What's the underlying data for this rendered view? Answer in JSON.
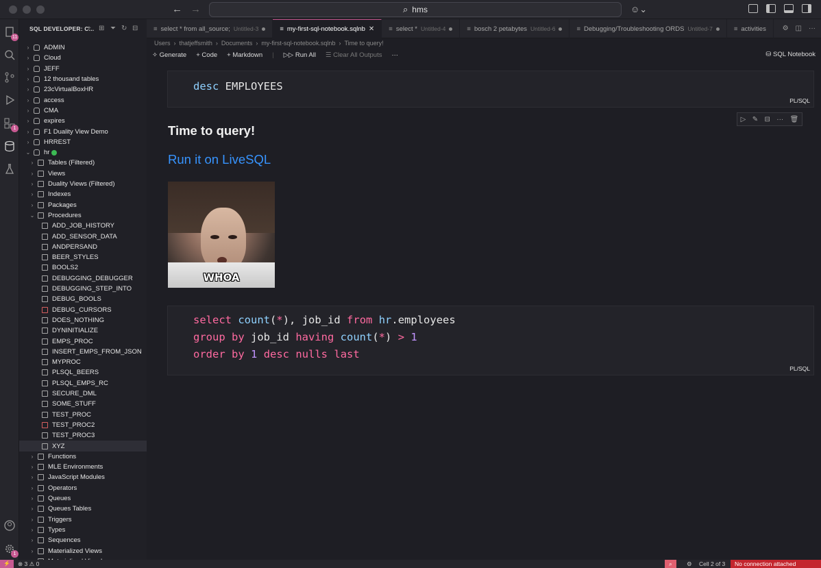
{
  "window": {
    "search_text": "hms",
    "back": "←",
    "forward": "→"
  },
  "sidebar": {
    "title": "SQL DEVELOPER: C...",
    "tree": [
      {
        "label": "ADMIN",
        "level": 0,
        "icon": "db",
        "chev": "›"
      },
      {
        "label": "Cloud",
        "level": 0,
        "icon": "db",
        "chev": "›"
      },
      {
        "label": "JEFF",
        "level": 0,
        "icon": "db",
        "chev": "›"
      },
      {
        "label": "12 thousand tables",
        "level": 0,
        "icon": "db",
        "chev": "›"
      },
      {
        "label": "23cVirtualBoxHR",
        "level": 0,
        "icon": "db",
        "chev": "›"
      },
      {
        "label": "access",
        "level": 0,
        "icon": "db",
        "chev": "›"
      },
      {
        "label": "CMA",
        "level": 0,
        "icon": "db",
        "chev": "›"
      },
      {
        "label": "expires",
        "level": 0,
        "icon": "db",
        "chev": "›"
      },
      {
        "label": "F1 Duality View Demo",
        "level": 0,
        "icon": "db",
        "chev": "›"
      },
      {
        "label": "HRREST",
        "level": 0,
        "icon": "db",
        "chev": "›"
      },
      {
        "label": "hr",
        "level": 0,
        "icon": "db",
        "chev": "⌄",
        "connected": true
      },
      {
        "label": "Tables (Filtered)",
        "level": 1,
        "icon": "folder",
        "chev": "›"
      },
      {
        "label": "Views",
        "level": 1,
        "icon": "folder",
        "chev": "›"
      },
      {
        "label": "Duality Views (Filtered)",
        "level": 1,
        "icon": "folder",
        "chev": "›"
      },
      {
        "label": "Indexes",
        "level": 1,
        "icon": "folder",
        "chev": "›"
      },
      {
        "label": "Packages",
        "level": 1,
        "icon": "folder",
        "chev": "›"
      },
      {
        "label": "Procedures",
        "level": 1,
        "icon": "folder",
        "chev": "⌄"
      },
      {
        "label": "ADD_JOB_HISTORY",
        "level": 2,
        "icon": "proc"
      },
      {
        "label": "ADD_SENSOR_DATA",
        "level": 2,
        "icon": "proc"
      },
      {
        "label": "ANDPERSAND",
        "level": 2,
        "icon": "proc"
      },
      {
        "label": "BEER_STYLES",
        "level": 2,
        "icon": "proc"
      },
      {
        "label": "BOOLS2",
        "level": 2,
        "icon": "proc"
      },
      {
        "label": "DEBUGGING_DEBUGGER",
        "level": 2,
        "icon": "proc"
      },
      {
        "label": "DEBUGGING_STEP_INTO",
        "level": 2,
        "icon": "proc"
      },
      {
        "label": "DEBUG_BOOLS",
        "level": 2,
        "icon": "proc"
      },
      {
        "label": "DEBUG_CURSORS",
        "level": 2,
        "icon": "proc-error"
      },
      {
        "label": "DOES_NOTHING",
        "level": 2,
        "icon": "proc"
      },
      {
        "label": "DYNINITIALIZE",
        "level": 2,
        "icon": "proc"
      },
      {
        "label": "EMPS_PROC",
        "level": 2,
        "icon": "proc"
      },
      {
        "label": "INSERT_EMPS_FROM_JSON",
        "level": 2,
        "icon": "proc"
      },
      {
        "label": "MYPROC",
        "level": 2,
        "icon": "proc"
      },
      {
        "label": "PLSQL_BEERS",
        "level": 2,
        "icon": "proc"
      },
      {
        "label": "PLSQL_EMPS_RC",
        "level": 2,
        "icon": "proc"
      },
      {
        "label": "SECURE_DML",
        "level": 2,
        "icon": "proc"
      },
      {
        "label": "SOME_STUFF",
        "level": 2,
        "icon": "proc"
      },
      {
        "label": "TEST_PROC",
        "level": 2,
        "icon": "proc"
      },
      {
        "label": "TEST_PROC2",
        "level": 2,
        "icon": "proc-error"
      },
      {
        "label": "TEST_PROC3",
        "level": 2,
        "icon": "proc"
      },
      {
        "label": "XYZ",
        "level": 2,
        "icon": "proc",
        "selected": true
      },
      {
        "label": "Functions",
        "level": 1,
        "icon": "folder",
        "chev": "›"
      },
      {
        "label": "MLE Environments",
        "level": 1,
        "icon": "folder",
        "chev": "›"
      },
      {
        "label": "JavaScript Modules",
        "level": 1,
        "icon": "folder",
        "chev": "›"
      },
      {
        "label": "Operators",
        "level": 1,
        "icon": "folder",
        "chev": "›"
      },
      {
        "label": "Queues",
        "level": 1,
        "icon": "folder",
        "chev": "›"
      },
      {
        "label": "Queues Tables",
        "level": 1,
        "icon": "folder",
        "chev": "›"
      },
      {
        "label": "Triggers",
        "level": 1,
        "icon": "folder",
        "chev": "›"
      },
      {
        "label": "Types",
        "level": 1,
        "icon": "folder",
        "chev": "›"
      },
      {
        "label": "Sequences",
        "level": 1,
        "icon": "folder",
        "chev": "›"
      },
      {
        "label": "Materialized Views",
        "level": 1,
        "icon": "folder",
        "chev": "›"
      },
      {
        "label": "Materialized View Logs",
        "level": 1,
        "icon": "folder",
        "chev": "›"
      }
    ]
  },
  "tabs": [
    {
      "label": "select * from all_source;",
      "sub": "Untitled-3",
      "active": false
    },
    {
      "label": "my-first-sql-notebook.sqlnb",
      "sub": "",
      "active": true
    },
    {
      "label": "select *",
      "sub": "Untitled-4",
      "active": false
    },
    {
      "label": "bosch 2 petabytes",
      "sub": "Untitled-6",
      "active": false
    },
    {
      "label": "Debugging/Troubleshooting ORDS",
      "sub": "Untitled-7",
      "active": false
    },
    {
      "label": "activities",
      "sub": "",
      "active": false
    }
  ],
  "breadcrumb": [
    "Users",
    "thatjeffsmith",
    "Documents",
    "my-first-sql-notebook.sqlnb",
    "Time to query!"
  ],
  "toolbar": {
    "generate": "Generate",
    "code": "Code",
    "markdown": "Markdown",
    "run_all": "Run All",
    "clear": "Clear All Outputs",
    "more": "···",
    "kernel": "SQL Notebook"
  },
  "cells": {
    "cell1": {
      "lang": "PL/SQL"
    },
    "markdown": {
      "title": "Time to query!",
      "link": "Run it on LiveSQL",
      "meme_caption": "WHOA"
    },
    "cell2": {
      "lang": "PL/SQL"
    }
  },
  "status": {
    "problems": "3",
    "warnings": "0",
    "cell": "Cell 2 of 3",
    "connection": "No connection attached"
  },
  "colors": {
    "accent": "#c85a92",
    "link": "#3794ff",
    "keyword": "#ff6aa0",
    "function": "#8fd1ff",
    "number": "#c294ff",
    "error": "#c4262e"
  }
}
